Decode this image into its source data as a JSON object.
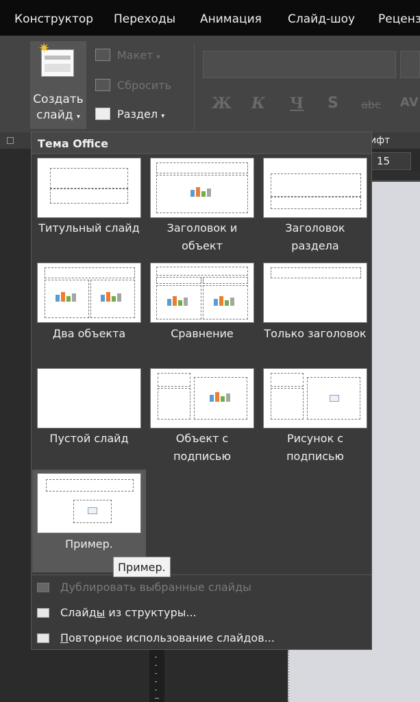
{
  "tabs": [
    "Конструктор",
    "Переходы",
    "Анимация",
    "Слайд-шоу",
    "Реценз"
  ],
  "ribbon": {
    "new_slide_line1": "Создать",
    "new_slide_line2": "слайд",
    "layout_label": "Макет",
    "reset_label": "Сбросить",
    "section_label": "Раздел",
    "bold": "Ж",
    "italic": "К",
    "underline": "Ч",
    "shadow": "S",
    "strike": "abc",
    "font_group_label": "ифт",
    "font_size": "15"
  },
  "gallery": {
    "title": "Тема Office",
    "layouts": [
      {
        "line1": "Титульный слайд",
        "line2": ""
      },
      {
        "line1": "Заголовок и",
        "line2": "объект"
      },
      {
        "line1": "Заголовок",
        "line2": "раздела"
      },
      {
        "line1": "Два объекта",
        "line2": ""
      },
      {
        "line1": "Сравнение",
        "line2": ""
      },
      {
        "line1": "Только заголовок",
        "line2": ""
      },
      {
        "line1": "Пустой слайд",
        "line2": ""
      },
      {
        "line1": "Объект с",
        "line2": "подписью"
      },
      {
        "line1": "Рисунок с",
        "line2": "подписью"
      },
      {
        "line1": "Пример.",
        "line2": ""
      }
    ],
    "selected_index": 9,
    "tooltip": "Пример."
  },
  "menu": {
    "duplicate": "Дублировать выбранные слайды",
    "outline_pre": "Слайд",
    "outline_u": "ы",
    "outline_post": " из структуры...",
    "reuse_u": "П",
    "reuse_post": "овторное использование слайдов..."
  },
  "colors": {
    "tab_bar": "#0b0b0b",
    "ribbon": "#444444",
    "dropdown": "#3a3a3a",
    "selected": "#595959",
    "accent_icon": "#f3c22e"
  }
}
